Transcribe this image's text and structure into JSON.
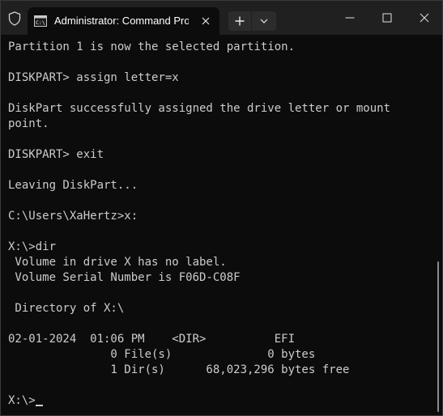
{
  "titlebar": {
    "tab_title": "Administrator: Command Prompt",
    "icons": {
      "shield": "shield-icon",
      "tab": "command-prompt-icon",
      "tab_close": "close-icon",
      "new_tab": "plus-icon",
      "dropdown": "chevron-down-icon",
      "minimize": "minimize-icon",
      "maximize": "maximize-icon",
      "close": "close-icon"
    }
  },
  "terminal": {
    "colors": {
      "background": "#0c0c0c",
      "foreground": "#cccccc"
    },
    "lines": [
      "Partition 1 is now the selected partition.",
      "",
      "DISKPART> assign letter=x",
      "",
      "DiskPart successfully assigned the drive letter or mount",
      "point.",
      "",
      "DISKPART> exit",
      "",
      "Leaving DiskPart...",
      "",
      "C:\\Users\\XaHertz>x:",
      "",
      "X:\\>dir",
      " Volume in drive X has no label.",
      " Volume Serial Number is F06D-C08F",
      "",
      " Directory of X:\\",
      "",
      "02-01-2024  01:06 PM    <DIR>          EFI",
      "               0 File(s)              0 bytes",
      "               1 Dir(s)      68,023,296 bytes free",
      ""
    ],
    "prompt": "X:\\>"
  }
}
